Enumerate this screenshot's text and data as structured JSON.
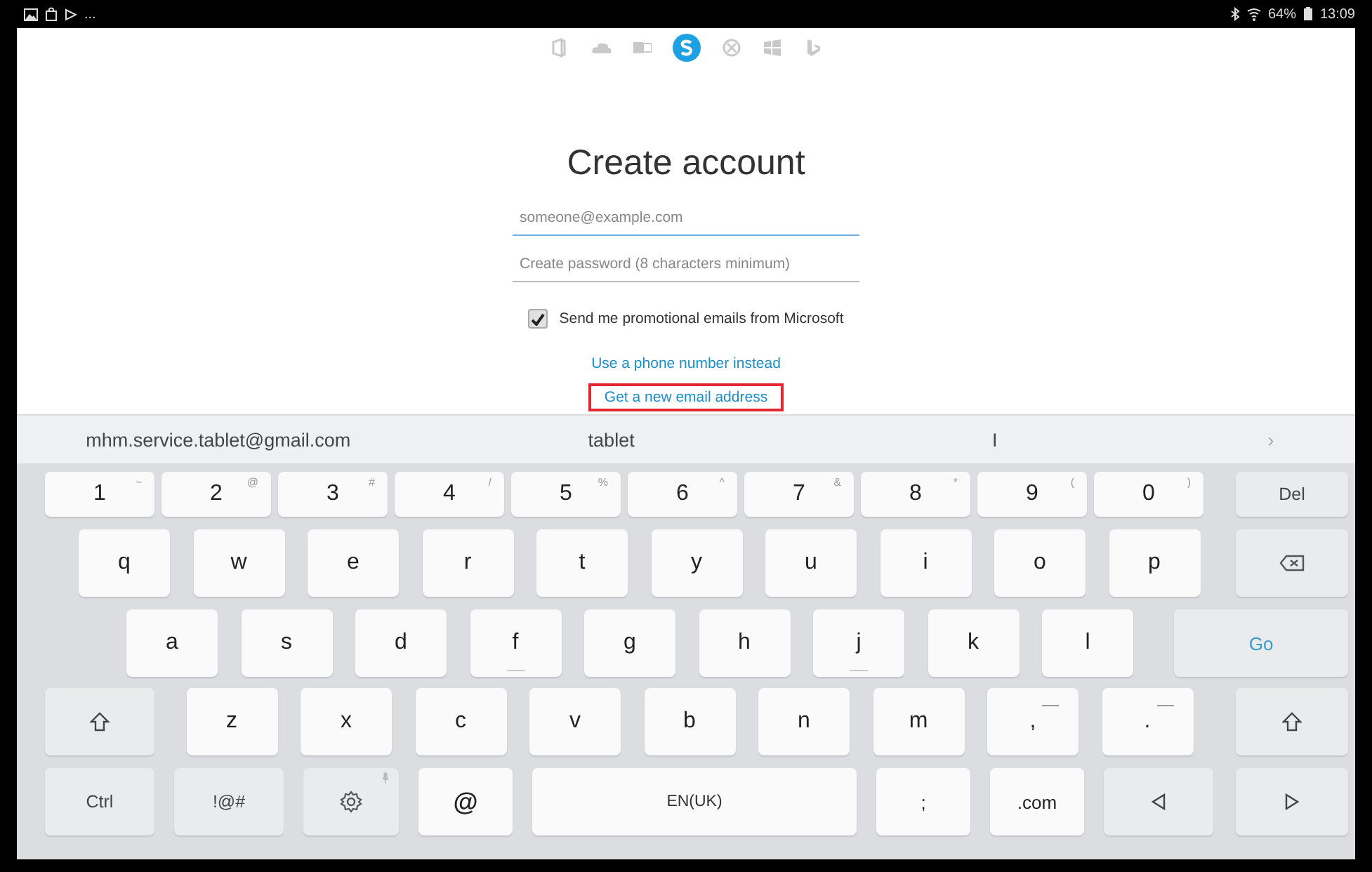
{
  "status_bar": {
    "left_more": "...",
    "battery_text": "64%",
    "time": "13:09"
  },
  "app_icons": [
    {
      "kind": "office",
      "selected": false
    },
    {
      "kind": "onedrive",
      "selected": false
    },
    {
      "kind": "outlook",
      "selected": false
    },
    {
      "kind": "skype",
      "selected": true
    },
    {
      "kind": "xbox",
      "selected": false
    },
    {
      "kind": "windows",
      "selected": false
    },
    {
      "kind": "bing",
      "selected": false
    }
  ],
  "form": {
    "title": "Create account",
    "email": {
      "placeholder": "someone@example.com",
      "focused": true
    },
    "password": {
      "placeholder": "Create password (8 characters minimum)",
      "focused": false
    },
    "promo": {
      "label": "Send me promotional emails from Microsoft",
      "checked": true
    },
    "links": [
      {
        "label": "Use a phone number instead",
        "highlighted": false
      },
      {
        "label": "Get a new email address",
        "highlighted": true
      }
    ]
  },
  "suggestions": {
    "items": [
      "mhm.service.tablet@gmail.com",
      "tablet",
      "I"
    ],
    "more": "›"
  },
  "keyboard": {
    "rows": [
      {
        "keys": [
          {
            "kind": "num",
            "label": "1",
            "hint": "~"
          },
          {
            "kind": "num",
            "label": "2",
            "hint": "@"
          },
          {
            "kind": "num",
            "label": "3",
            "hint": "#"
          },
          {
            "kind": "num",
            "label": "4",
            "hint": "/"
          },
          {
            "kind": "num",
            "label": "5",
            "hint": "%"
          },
          {
            "kind": "num",
            "label": "6",
            "hint": "^"
          },
          {
            "kind": "num",
            "label": "7",
            "hint": "&"
          },
          {
            "kind": "num",
            "label": "8",
            "hint": "*"
          },
          {
            "kind": "num",
            "label": "9",
            "hint": "("
          },
          {
            "kind": "num",
            "label": "0",
            "hint": ")"
          },
          {
            "kind": "func",
            "label": "Del"
          }
        ]
      },
      {
        "keys": [
          {
            "kind": "letter",
            "label": "q"
          },
          {
            "kind": "letter",
            "label": "w"
          },
          {
            "kind": "letter",
            "label": "e"
          },
          {
            "kind": "letter",
            "label": "r"
          },
          {
            "kind": "letter",
            "label": "t"
          },
          {
            "kind": "letter",
            "label": "y"
          },
          {
            "kind": "letter",
            "label": "u"
          },
          {
            "kind": "letter",
            "label": "i"
          },
          {
            "kind": "letter",
            "label": "o"
          },
          {
            "kind": "letter",
            "label": "p"
          },
          {
            "kind": "backspace"
          }
        ]
      },
      {
        "keys": [
          {
            "kind": "letter",
            "label": "a"
          },
          {
            "kind": "letter",
            "label": "s"
          },
          {
            "kind": "letter",
            "label": "d"
          },
          {
            "kind": "letter",
            "label": "f",
            "bump": true
          },
          {
            "kind": "letter",
            "label": "g"
          },
          {
            "kind": "letter",
            "label": "h"
          },
          {
            "kind": "letter",
            "label": "j",
            "bump": true
          },
          {
            "kind": "letter",
            "label": "k"
          },
          {
            "kind": "letter",
            "label": "l"
          },
          {
            "kind": "go",
            "label": "Go"
          }
        ]
      },
      {
        "keys": [
          {
            "kind": "shift"
          },
          {
            "kind": "letter",
            "label": "z"
          },
          {
            "kind": "letter",
            "label": "x"
          },
          {
            "kind": "letter",
            "label": "c"
          },
          {
            "kind": "letter",
            "label": "v"
          },
          {
            "kind": "letter",
            "label": "b"
          },
          {
            "kind": "letter",
            "label": "n"
          },
          {
            "kind": "letter",
            "label": "m"
          },
          {
            "kind": "letter",
            "label": ",",
            "dash": true
          },
          {
            "kind": "letter",
            "label": ".",
            "dash": true
          },
          {
            "kind": "shift"
          }
        ]
      },
      {
        "keys": [
          {
            "kind": "func",
            "label": "Ctrl"
          },
          {
            "kind": "func",
            "label": "!@#"
          },
          {
            "kind": "settings"
          },
          {
            "kind": "sym",
            "label": "@"
          },
          {
            "kind": "space",
            "label": "EN(UK)"
          },
          {
            "kind": "sym",
            "label": ";"
          },
          {
            "kind": "sym",
            "label": ".com"
          },
          {
            "kind": "left"
          },
          {
            "kind": "right"
          }
        ]
      }
    ]
  }
}
